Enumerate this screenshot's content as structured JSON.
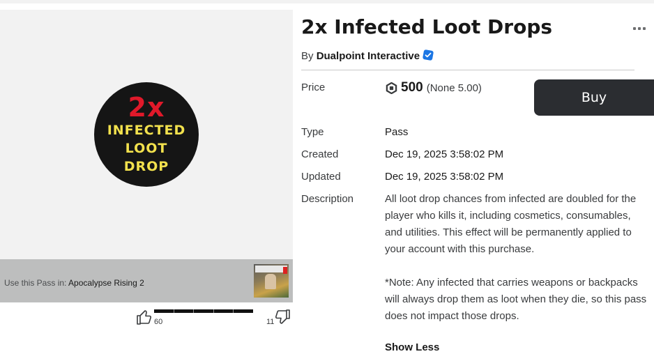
{
  "item": {
    "title": "2x Infected Loot Drops",
    "by_prefix": "By",
    "creator": "Dualpoint Interactive",
    "creator_verified": true
  },
  "badge_image": {
    "big_text": "2x",
    "line1": "INFECTED",
    "line2": "LOOT",
    "line3": "DROP",
    "colors": {
      "background": "#151515",
      "big": "#e0192a",
      "lines": "#f2e14d"
    }
  },
  "use_pass": {
    "prefix": "Use this Pass in:",
    "game": "Apocalypse Rising 2"
  },
  "votes": {
    "up": "60",
    "down": "11"
  },
  "labels": {
    "price": "Price",
    "type": "Type",
    "created": "Created",
    "updated": "Updated",
    "description": "Description"
  },
  "price": {
    "amount": "500",
    "note": "(None 5.00)",
    "icon": "robux-icon"
  },
  "buy_label": "Buy",
  "details": {
    "type": "Pass",
    "created": "Dec 19, 2025 3:58:02 PM",
    "updated": "Dec 19, 2025 3:58:02 PM"
  },
  "description_text": "All loot drop chances from infected are doubled for the player who kills it, including cosmetics, consumables, and utilities. This effect will be permanently applied to your account with this purchase.\n\n*Note: Any infected that carries weapons or backpacks will always drop them as loot when they die, so this pass does not impact those drops.",
  "show_less": "Show Less",
  "colors": {
    "buy_bg": "#2b2d31",
    "verified": "#1b76e4",
    "title": "#191919"
  }
}
